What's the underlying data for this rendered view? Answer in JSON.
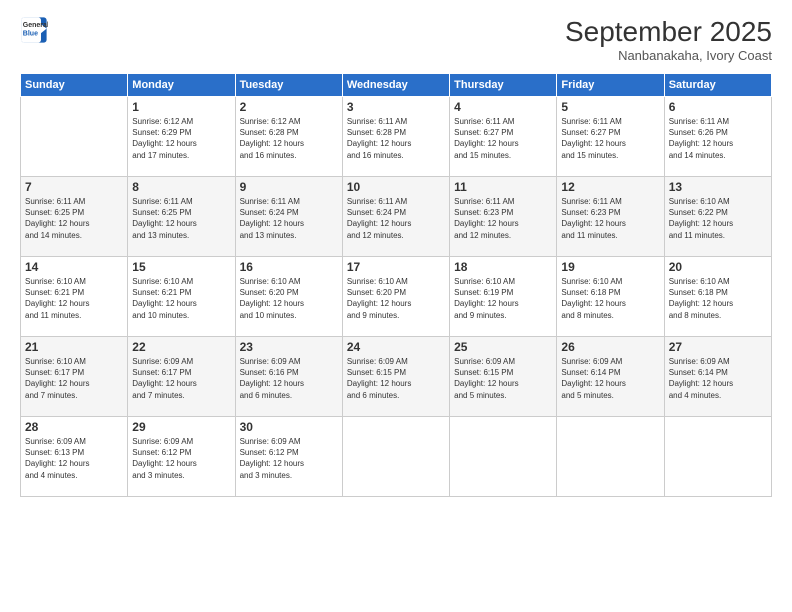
{
  "logo": {
    "line1": "General",
    "line2": "Blue"
  },
  "title": "September 2025",
  "subtitle": "Nanbanakaha, Ivory Coast",
  "days_header": [
    "Sunday",
    "Monday",
    "Tuesday",
    "Wednesday",
    "Thursday",
    "Friday",
    "Saturday"
  ],
  "weeks": [
    [
      {
        "day": "",
        "info": ""
      },
      {
        "day": "1",
        "info": "Sunrise: 6:12 AM\nSunset: 6:29 PM\nDaylight: 12 hours\nand 17 minutes."
      },
      {
        "day": "2",
        "info": "Sunrise: 6:12 AM\nSunset: 6:28 PM\nDaylight: 12 hours\nand 16 minutes."
      },
      {
        "day": "3",
        "info": "Sunrise: 6:11 AM\nSunset: 6:28 PM\nDaylight: 12 hours\nand 16 minutes."
      },
      {
        "day": "4",
        "info": "Sunrise: 6:11 AM\nSunset: 6:27 PM\nDaylight: 12 hours\nand 15 minutes."
      },
      {
        "day": "5",
        "info": "Sunrise: 6:11 AM\nSunset: 6:27 PM\nDaylight: 12 hours\nand 15 minutes."
      },
      {
        "day": "6",
        "info": "Sunrise: 6:11 AM\nSunset: 6:26 PM\nDaylight: 12 hours\nand 14 minutes."
      }
    ],
    [
      {
        "day": "7",
        "info": "Sunrise: 6:11 AM\nSunset: 6:25 PM\nDaylight: 12 hours\nand 14 minutes."
      },
      {
        "day": "8",
        "info": "Sunrise: 6:11 AM\nSunset: 6:25 PM\nDaylight: 12 hours\nand 13 minutes."
      },
      {
        "day": "9",
        "info": "Sunrise: 6:11 AM\nSunset: 6:24 PM\nDaylight: 12 hours\nand 13 minutes."
      },
      {
        "day": "10",
        "info": "Sunrise: 6:11 AM\nSunset: 6:24 PM\nDaylight: 12 hours\nand 12 minutes."
      },
      {
        "day": "11",
        "info": "Sunrise: 6:11 AM\nSunset: 6:23 PM\nDaylight: 12 hours\nand 12 minutes."
      },
      {
        "day": "12",
        "info": "Sunrise: 6:11 AM\nSunset: 6:23 PM\nDaylight: 12 hours\nand 11 minutes."
      },
      {
        "day": "13",
        "info": "Sunrise: 6:10 AM\nSunset: 6:22 PM\nDaylight: 12 hours\nand 11 minutes."
      }
    ],
    [
      {
        "day": "14",
        "info": "Sunrise: 6:10 AM\nSunset: 6:21 PM\nDaylight: 12 hours\nand 11 minutes."
      },
      {
        "day": "15",
        "info": "Sunrise: 6:10 AM\nSunset: 6:21 PM\nDaylight: 12 hours\nand 10 minutes."
      },
      {
        "day": "16",
        "info": "Sunrise: 6:10 AM\nSunset: 6:20 PM\nDaylight: 12 hours\nand 10 minutes."
      },
      {
        "day": "17",
        "info": "Sunrise: 6:10 AM\nSunset: 6:20 PM\nDaylight: 12 hours\nand 9 minutes."
      },
      {
        "day": "18",
        "info": "Sunrise: 6:10 AM\nSunset: 6:19 PM\nDaylight: 12 hours\nand 9 minutes."
      },
      {
        "day": "19",
        "info": "Sunrise: 6:10 AM\nSunset: 6:18 PM\nDaylight: 12 hours\nand 8 minutes."
      },
      {
        "day": "20",
        "info": "Sunrise: 6:10 AM\nSunset: 6:18 PM\nDaylight: 12 hours\nand 8 minutes."
      }
    ],
    [
      {
        "day": "21",
        "info": "Sunrise: 6:10 AM\nSunset: 6:17 PM\nDaylight: 12 hours\nand 7 minutes."
      },
      {
        "day": "22",
        "info": "Sunrise: 6:09 AM\nSunset: 6:17 PM\nDaylight: 12 hours\nand 7 minutes."
      },
      {
        "day": "23",
        "info": "Sunrise: 6:09 AM\nSunset: 6:16 PM\nDaylight: 12 hours\nand 6 minutes."
      },
      {
        "day": "24",
        "info": "Sunrise: 6:09 AM\nSunset: 6:15 PM\nDaylight: 12 hours\nand 6 minutes."
      },
      {
        "day": "25",
        "info": "Sunrise: 6:09 AM\nSunset: 6:15 PM\nDaylight: 12 hours\nand 5 minutes."
      },
      {
        "day": "26",
        "info": "Sunrise: 6:09 AM\nSunset: 6:14 PM\nDaylight: 12 hours\nand 5 minutes."
      },
      {
        "day": "27",
        "info": "Sunrise: 6:09 AM\nSunset: 6:14 PM\nDaylight: 12 hours\nand 4 minutes."
      }
    ],
    [
      {
        "day": "28",
        "info": "Sunrise: 6:09 AM\nSunset: 6:13 PM\nDaylight: 12 hours\nand 4 minutes."
      },
      {
        "day": "29",
        "info": "Sunrise: 6:09 AM\nSunset: 6:12 PM\nDaylight: 12 hours\nand 3 minutes."
      },
      {
        "day": "30",
        "info": "Sunrise: 6:09 AM\nSunset: 6:12 PM\nDaylight: 12 hours\nand 3 minutes."
      },
      {
        "day": "",
        "info": ""
      },
      {
        "day": "",
        "info": ""
      },
      {
        "day": "",
        "info": ""
      },
      {
        "day": "",
        "info": ""
      }
    ]
  ]
}
